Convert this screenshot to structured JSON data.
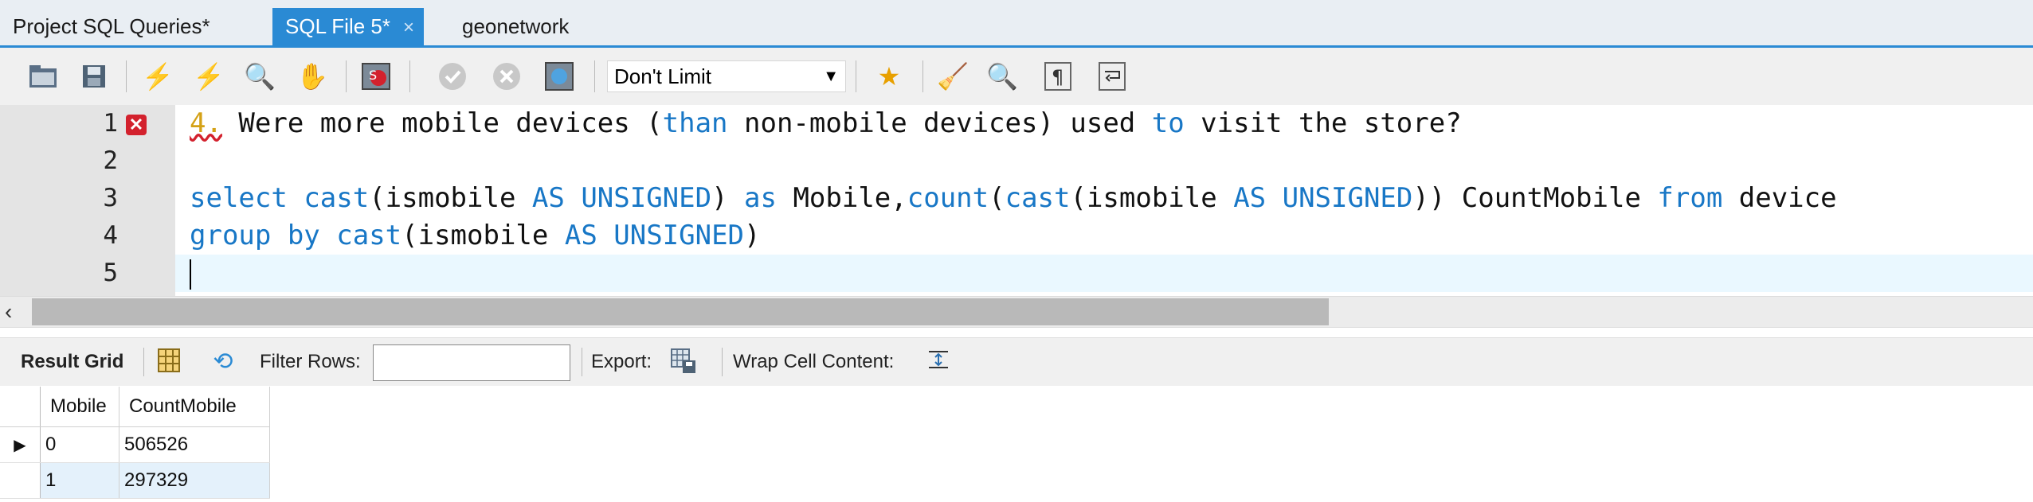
{
  "tabs": [
    {
      "label": "Project SQL Queries*"
    },
    {
      "label": "SQL File 5*",
      "close": "×"
    },
    {
      "label": "geonetwork"
    }
  ],
  "toolbar": {
    "limit_value": "Don't Limit"
  },
  "editor": {
    "line_numbers": [
      "1",
      "2",
      "3",
      "4",
      "5"
    ],
    "line1": {
      "number": "4.",
      "t1": " Were more mobile devices (",
      "than": "than",
      "t2": " non-mobile devices) used ",
      "to": "to",
      "t3": " visit the store?"
    },
    "line3": {
      "select": "select",
      "cast1": "cast",
      "t1": "(ismobile ",
      "as_unsigned1": "AS UNSIGNED",
      "t2": ") ",
      "as": "as",
      "t3": " Mobile,",
      "count": "count",
      "t4": "(",
      "cast2": "cast",
      "t5": "(ismobile ",
      "as_unsigned2": "AS UNSIGNED",
      "t6": ")) CountMobile ",
      "from": "from",
      "t7": " device"
    },
    "line4": {
      "group_by": "group by",
      "t1": " ",
      "cast": "cast",
      "t2": "(ismobile ",
      "as_unsigned": "AS UNSIGNED",
      "t3": ")"
    }
  },
  "result_toolbar": {
    "result_grid": "Result Grid",
    "filter_rows": "Filter Rows:",
    "filter_value": "",
    "export": "Export:",
    "wrap_cell": "Wrap Cell Content:"
  },
  "result": {
    "columns": [
      "Mobile",
      "CountMobile"
    ],
    "rows": [
      {
        "mobile": "0",
        "count": "506526"
      },
      {
        "mobile": "1",
        "count": "297329"
      }
    ]
  },
  "colors": {
    "accent": "#2a8ad4",
    "keyword": "#1877c6",
    "error": "#d3212d"
  }
}
